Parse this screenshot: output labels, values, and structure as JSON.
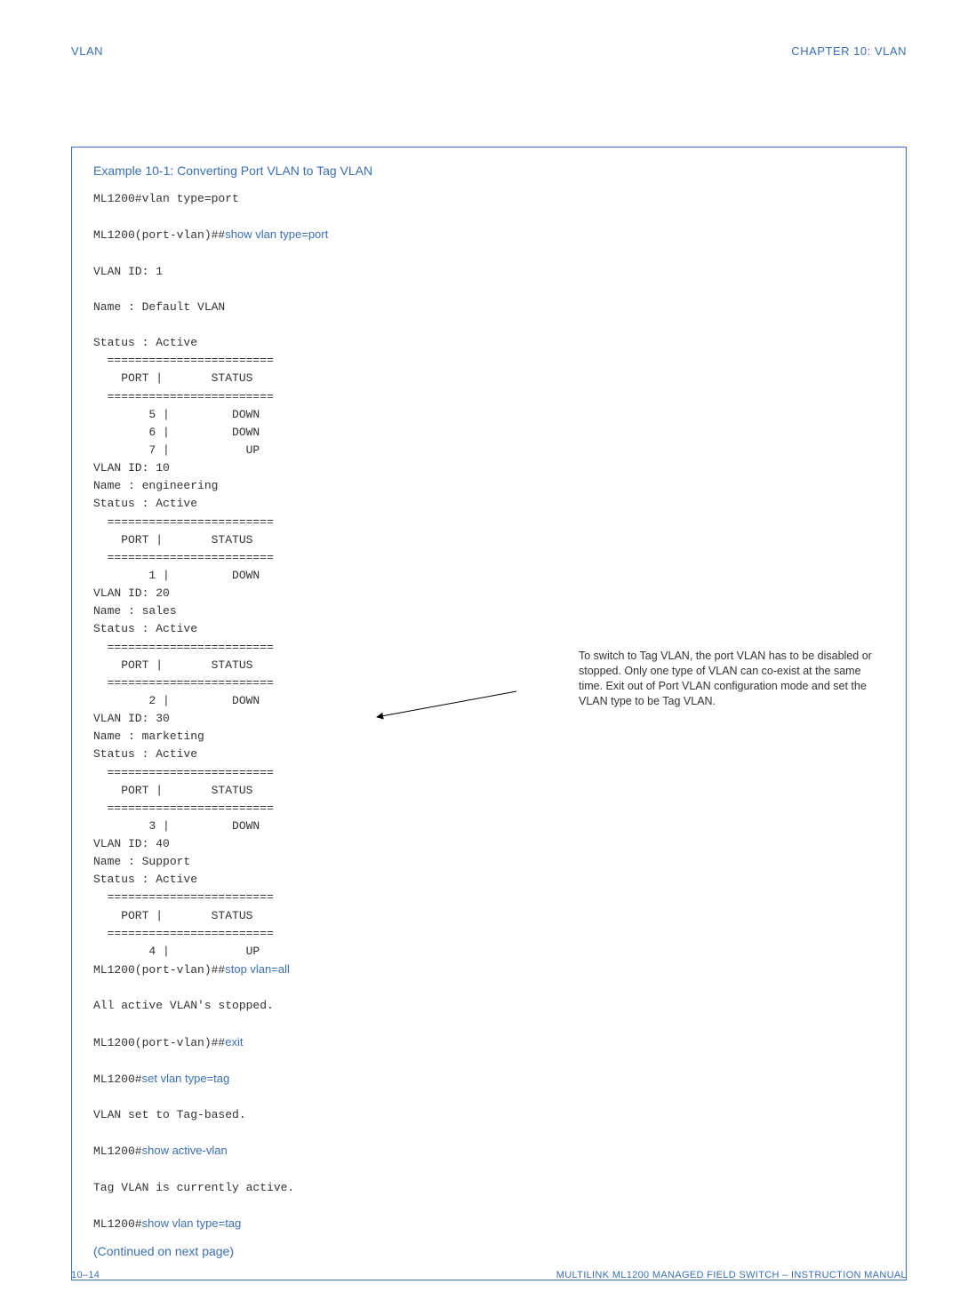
{
  "header": {
    "left": "VLAN",
    "right": "CHAPTER 10:  VLAN"
  },
  "example": {
    "title": "Example 10-1: Converting Port VLAN to Tag VLAN",
    "continued": "(Continued on next page)"
  },
  "cmds": {
    "l1": "ML1200#vlan type=port",
    "l2_pref": "ML1200(port-vlan)##",
    "l2_cmd": "show vlan type=port",
    "block1": "VLAN ID: 1\n\nName : Default VLAN\n\nStatus : Active\n  ========================\n    PORT |       STATUS\n  ========================\n        5 |         DOWN\n        6 |         DOWN\n        7 |           UP\nVLAN ID: 10\nName : engineering\nStatus : Active\n  ========================\n    PORT |       STATUS\n  ========================\n        1 |         DOWN\nVLAN ID: 20\nName : sales\nStatus : Active\n  ========================\n    PORT |       STATUS\n  ========================\n        2 |         DOWN\nVLAN ID: 30\nName : marketing\nStatus : Active\n  ========================\n    PORT |       STATUS\n  ========================\n        3 |         DOWN\nVLAN ID: 40\nName : Support\nStatus : Active\n  ========================\n    PORT |       STATUS\n  ========================\n        4 |           UP",
    "l3_pref": "ML1200(port-vlan)##",
    "l3_cmd": "stop vlan=all",
    "l4": "All active VLAN's stopped.",
    "l5_pref": "ML1200(port-vlan)##",
    "l5_cmd": "exit",
    "l6_pref": "ML1200#",
    "l6_cmd": "set vlan type=tag",
    "l7": "VLAN set to Tag-based.",
    "l8_pref": "ML1200#",
    "l8_cmd": "show active-vlan",
    "l9": "Tag VLAN is currently active.",
    "l10_pref": "ML1200#",
    "l10_cmd": "show vlan type=tag"
  },
  "callout": "To switch to Tag VLAN, the port VLAN has to be disabled or stopped. Only one type of VLAN can co-exist at the same time. Exit out of Port VLAN configuration mode and set the VLAN type to be Tag VLAN.",
  "footer": {
    "left": "10–14",
    "right": "MULTILINK ML1200 MANAGED FIELD SWITCH – INSTRUCTION MANUAL"
  }
}
